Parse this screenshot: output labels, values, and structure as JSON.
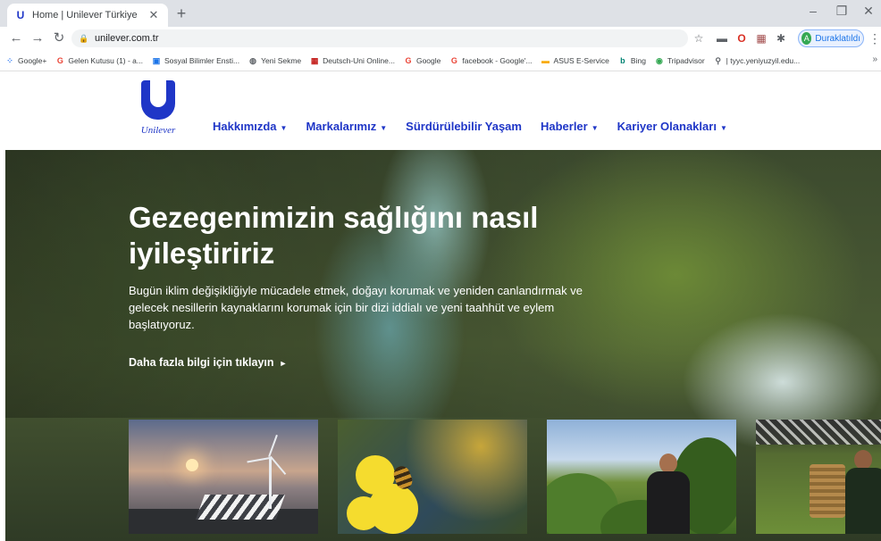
{
  "browser": {
    "tab": {
      "title": "Home | Unilever Türkiye",
      "favicon_icon": "unilever-favicon"
    },
    "url": "unilever.com.tr",
    "profile_label": "Duraklatıldı",
    "profile_initial": "A",
    "bookmarks": [
      {
        "label": "Google+",
        "icon": "apps-icon",
        "color": "#4285f4"
      },
      {
        "label": "Gelen Kutusu (1) - a...",
        "icon": "google-icon",
        "color": "#ea4335"
      },
      {
        "label": "Sosyal Bilimler Ensti...",
        "icon": "bookmark-icon",
        "color": "#1a73e8"
      },
      {
        "label": "Yeni Sekme",
        "icon": "globe-icon",
        "color": "#5f6368"
      },
      {
        "label": "Deutsch-Uni Online...",
        "icon": "grid-icon",
        "color": "#c5221f"
      },
      {
        "label": "Google",
        "icon": "google-icon",
        "color": "#ea4335"
      },
      {
        "label": "facebook - Google'...",
        "icon": "google-icon",
        "color": "#ea4335"
      },
      {
        "label": "ASUS E-Service",
        "icon": "folder-icon",
        "color": "#f9ab00"
      },
      {
        "label": "Bing",
        "icon": "bing-icon",
        "color": "#008373"
      },
      {
        "label": "Tripadvisor",
        "icon": "owl-icon",
        "color": "#34a853"
      },
      {
        "label": "| tyyc.yeniyuzyil.edu...",
        "icon": "link-icon",
        "color": "#5f6368"
      }
    ]
  },
  "site": {
    "logo_text": "Unilever",
    "nav": [
      {
        "label": "Hakkımızda",
        "has_dropdown": true
      },
      {
        "label": "Markalarımız",
        "has_dropdown": true
      },
      {
        "label": "Sürdürülebilir Yaşam",
        "has_dropdown": false
      },
      {
        "label": "Haberler",
        "has_dropdown": true
      },
      {
        "label": "Kariyer Olanakları",
        "has_dropdown": true
      }
    ],
    "brand_color": "#1f36c7"
  },
  "hero": {
    "title": "Gezegenimizin sağlığını nasıl iyileştiririz",
    "description": "Bugün iklim değişikliğiyle mücadele etmek, doğayı korumak ve yeniden canlandırmak ve gelecek nesillerin kaynaklarını korumak için bir dizi iddialı ve yeni taahhüt ve eylem başlatıyoruz.",
    "cta": "Daha fazla bilgi için tıklayın"
  }
}
